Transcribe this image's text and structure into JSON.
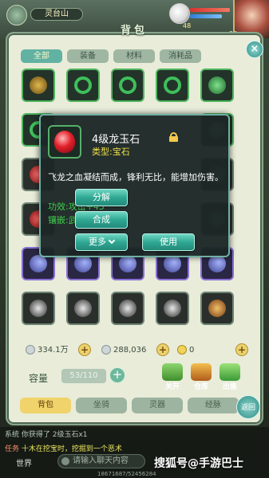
{
  "hud": {
    "map_name": "灵台山",
    "pet_level": "48",
    "hero_level": "26"
  },
  "panel": {
    "title": "背包",
    "close_glyph": "×"
  },
  "tabs": [
    {
      "label": "全部",
      "active": true
    },
    {
      "label": "装备",
      "active": false
    },
    {
      "label": "材料",
      "active": false
    },
    {
      "label": "消耗品",
      "active": false
    }
  ],
  "slot_colors": {
    "green_border": "#4fb55e",
    "purple_border": "#8a6fd6"
  },
  "resources": {
    "silver": "334.1万",
    "gold": "288,036",
    "diamond": "0",
    "plus_glyph": "+"
  },
  "capacity": {
    "label": "容量",
    "value": "53/110",
    "plus_glyph": "+"
  },
  "side_buttons": [
    {
      "label": "关开"
    },
    {
      "label": "仓库"
    },
    {
      "label": "出售"
    }
  ],
  "bottom_tabs": [
    {
      "label": "背包",
      "active": true
    },
    {
      "label": "坐骑",
      "active": false
    },
    {
      "label": "灵器",
      "active": false
    },
    {
      "label": "经脉",
      "active": false
    }
  ],
  "back_label": "返回",
  "chat": {
    "line1": "系统  你获得了 2级玉石x1",
    "line2_tag": "任务",
    "line2_text": "十木在挖宝时，挖掘到一个恶术",
    "channel": "世界",
    "input_placeholder": "请输入聊天内容",
    "coords": "18671687/52456284"
  },
  "watermark": "搜狐号@手游巴士",
  "tooltip": {
    "name": "4级龙玉石",
    "type": "类型:宝石",
    "description": "飞龙之血凝结而成，锋利无比，能增加伤害。",
    "effect": "功效:攻击+45",
    "inlay": "镶嵌:武器、戒指",
    "buttons": {
      "decompose": "分解",
      "combine": "合成",
      "more": "更多",
      "use": "使用"
    }
  }
}
